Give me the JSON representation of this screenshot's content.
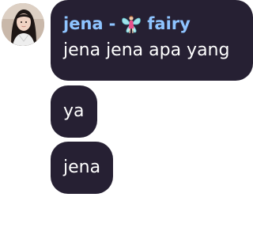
{
  "avatar": {
    "icon": "user-avatar-photo"
  },
  "messages": [
    {
      "sender": "jena",
      "separator": "-",
      "badge_icon": "fairy-icon",
      "badge_text": "fairy",
      "text": "jena jena apa yang"
    },
    {
      "text": "ya"
    },
    {
      "text": "jena"
    }
  ],
  "colors": {
    "bubble_background": "#262033",
    "sender_name": "#8ec4ff",
    "message_text": "#ffffff",
    "page_background": "#ffffff"
  }
}
